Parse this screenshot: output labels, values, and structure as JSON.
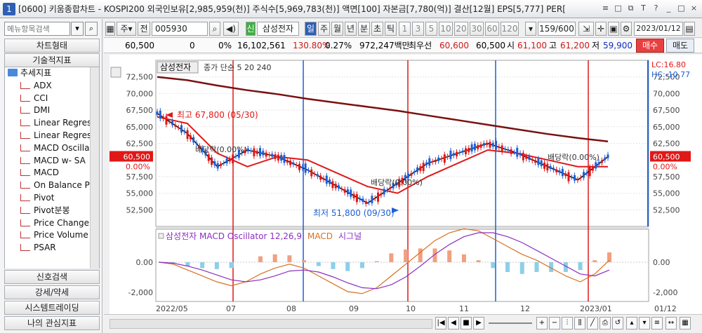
{
  "window": {
    "num": "1",
    "title": "[0600] 키움종합차트 - KOSPI200 외국인보유[2,985,959(천)] 주식수[5,969,783(천)] 액면[100] 자본금[7,780(억)] 결산[12월] EPS[5,777] PER[",
    "buttons": [
      "≡",
      "□",
      "⧉",
      "T",
      "?",
      "_",
      "□",
      "×"
    ]
  },
  "left_panel": {
    "search_placeholder": "메뉴항목검색",
    "section_chart_type": "차트형태",
    "section_indicators": "기술적지표",
    "tree_folder": "추세지표",
    "tree_items": [
      "ADX",
      "CCI",
      "DMI",
      "Linear Regres",
      "Linear Regres",
      "MACD Oscilla",
      "MACD w- SA",
      "MACD",
      "On Balance P",
      "Pivot",
      "Pivot분봉",
      "Price Change",
      "Price Volume",
      "PSAR"
    ],
    "bottom_sections": [
      "신호검색",
      "강세/약세",
      "시스템트레이딩",
      "나의 관심지표"
    ]
  },
  "toolbar": {
    "type_select": "주",
    "prev_label": "전",
    "code": "005930",
    "credit_badge": "신",
    "stock_name": "삼성전자",
    "periods": [
      "일",
      "주",
      "월",
      "년",
      "분",
      "초",
      "틱"
    ],
    "minutes": [
      "1",
      "3",
      "5",
      "10",
      "20",
      "30",
      "60",
      "120"
    ],
    "count": "159/600",
    "date": "2023/01/12"
  },
  "quote": {
    "price": "60,500",
    "change": "0",
    "change_pct": "0%",
    "volume": "16,102,561",
    "vol_ratio": "130.80%",
    "turnover_pct": "0.27%",
    "amount": "972,247백만",
    "best_label": "최우선",
    "ask": "60,600",
    "bid": "60,500",
    "open_label": "시",
    "open": "61,100",
    "high_label": "고",
    "high": "61,200",
    "low_label": "저",
    "low": "59,900",
    "buy_button": "매수",
    "sell_button": "매도"
  },
  "chart": {
    "legend_name": "삼성전자",
    "legend_ma": "종가 단순 5 20 240",
    "ma_5_label": "5",
    "ma_20_label": "20",
    "ma_240_label": "240",
    "high_annot": "최고 67,800 (05/30)",
    "low_annot": "최저 51,800 (09/30)",
    "dividend_1": "배당락(0.00%)",
    "dividend_2": "배당락(0.00%)",
    "dividend_3": "배당락(0.00%)",
    "lc_label": "LC:16.80",
    "hc_label": "HC:-10.77",
    "current_price": "60,500",
    "current_pct": "0.00%",
    "current_price_right": "60,500",
    "current_pct_right": "0.00%",
    "price_axis": [
      "72,500",
      "70,000",
      "67,500",
      "65,000",
      "62,500",
      "57,500",
      "55,000",
      "52,500"
    ],
    "price_axis_right": [
      "72,500",
      "70,000",
      "67,500",
      "65,000",
      "62,500",
      "57,500",
      "55,000",
      "52,500"
    ],
    "macd_legend": "삼성전자 MACD Oscillator 12,26,9",
    "macd_legend_macd": "MACD",
    "macd_legend_signal": "시그널",
    "macd_axis": [
      "0.00",
      "-2,000"
    ],
    "macd_axis_right": [
      "0.00",
      "-2,000"
    ],
    "x_axis": [
      "2022/05",
      "07",
      "08",
      "09",
      "10",
      "11",
      "12",
      "2023/01"
    ],
    "x_axis_right": "01/12",
    "colors": {
      "up": "#e01818",
      "down": "#1d5fd6",
      "ma5": "#000000",
      "ma20": "#e01818",
      "ma240": "#7a1010",
      "macd": "#d87020",
      "signal": "#8b2fc0",
      "osc": "#f0a080"
    }
  },
  "chart_data": {
    "type": "line",
    "title": "",
    "x": [
      "2022/05",
      "07",
      "08",
      "09",
      "10",
      "11",
      "12",
      "2023/01"
    ],
    "ylim": [
      50000,
      75000
    ],
    "series": [
      {
        "name": "5",
        "values": [
          67000,
          64000,
          59000,
          61500,
          60500,
          58500,
          56000,
          53500,
          56500,
          59500,
          61000,
          62500,
          61000,
          59000,
          57000,
          60500
        ]
      },
      {
        "name": "20",
        "values": [
          66500,
          65500,
          61000,
          59000,
          60500,
          60000,
          58000,
          56000,
          55000,
          57500,
          59500,
          61500,
          61000,
          60000,
          59000,
          59000
        ]
      },
      {
        "name": "240",
        "values": [
          72500,
          72000,
          71200,
          70500,
          69900,
          69200,
          68600,
          68000,
          67400,
          66700,
          66000,
          65300,
          64600,
          63900,
          63300,
          62800
        ]
      }
    ],
    "annotations": [
      "최고 67,800 (05/30)",
      "최저 51,800 (09/30)"
    ]
  }
}
